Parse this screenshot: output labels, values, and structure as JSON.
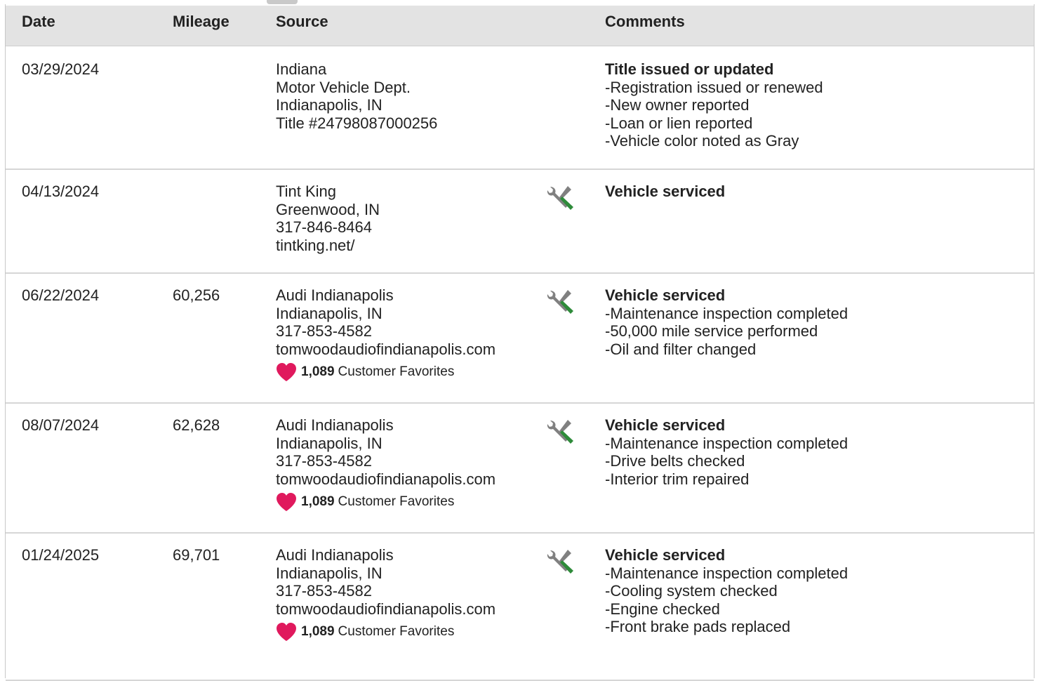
{
  "header": {
    "date": "Date",
    "mileage": "Mileage",
    "source": "Source",
    "comments": "Comments"
  },
  "colors": {
    "heart": "#e0195d",
    "wrench_green": "#2e8b3a",
    "tool_gray": "#808080"
  },
  "records": [
    {
      "date": "03/29/2024",
      "mileage": "",
      "source": [
        "Indiana",
        "Motor Vehicle Dept.",
        "Indianapolis, IN",
        "Title #24798087000256"
      ],
      "icon": "",
      "favorites": null,
      "comment_title": "Title issued or updated",
      "comment_items": [
        "Registration issued or renewed",
        "New owner reported",
        "Loan or lien reported",
        "Vehicle color noted as Gray"
      ]
    },
    {
      "date": "04/13/2024",
      "mileage": "",
      "source": [
        "Tint King",
        "Greenwood, IN",
        "317-846-8464",
        "tintking.net/"
      ],
      "icon": "service-tools-icon",
      "favorites": null,
      "comment_title": "Vehicle serviced",
      "comment_items": []
    },
    {
      "date": "06/22/2024",
      "mileage": "60,256",
      "source": [
        "Audi Indianapolis",
        "Indianapolis, IN",
        "317-853-4582",
        "tomwoodaudiofindianapolis.com"
      ],
      "icon": "service-tools-icon",
      "favorites": {
        "count": "1,089",
        "label": "Customer Favorites"
      },
      "comment_title": "Vehicle serviced",
      "comment_items": [
        "Maintenance inspection completed",
        "50,000 mile service performed",
        "Oil and filter changed"
      ]
    },
    {
      "date": "08/07/2024",
      "mileage": "62,628",
      "source": [
        "Audi Indianapolis",
        "Indianapolis, IN",
        "317-853-4582",
        "tomwoodaudiofindianapolis.com"
      ],
      "icon": "service-tools-icon",
      "favorites": {
        "count": "1,089",
        "label": "Customer Favorites"
      },
      "comment_title": "Vehicle serviced",
      "comment_items": [
        "Maintenance inspection completed",
        "Drive belts checked",
        "Interior trim repaired"
      ]
    },
    {
      "date": "01/24/2025",
      "mileage": "69,701",
      "source": [
        "Audi Indianapolis",
        "Indianapolis, IN",
        "317-853-4582",
        "tomwoodaudiofindianapolis.com"
      ],
      "icon": "service-tools-icon",
      "favorites": {
        "count": "1,089",
        "label": "Customer Favorites"
      },
      "comment_title": "Vehicle serviced",
      "comment_items": [
        "Maintenance inspection completed",
        "Cooling system checked",
        "Engine checked",
        "Front brake pads replaced"
      ]
    }
  ]
}
